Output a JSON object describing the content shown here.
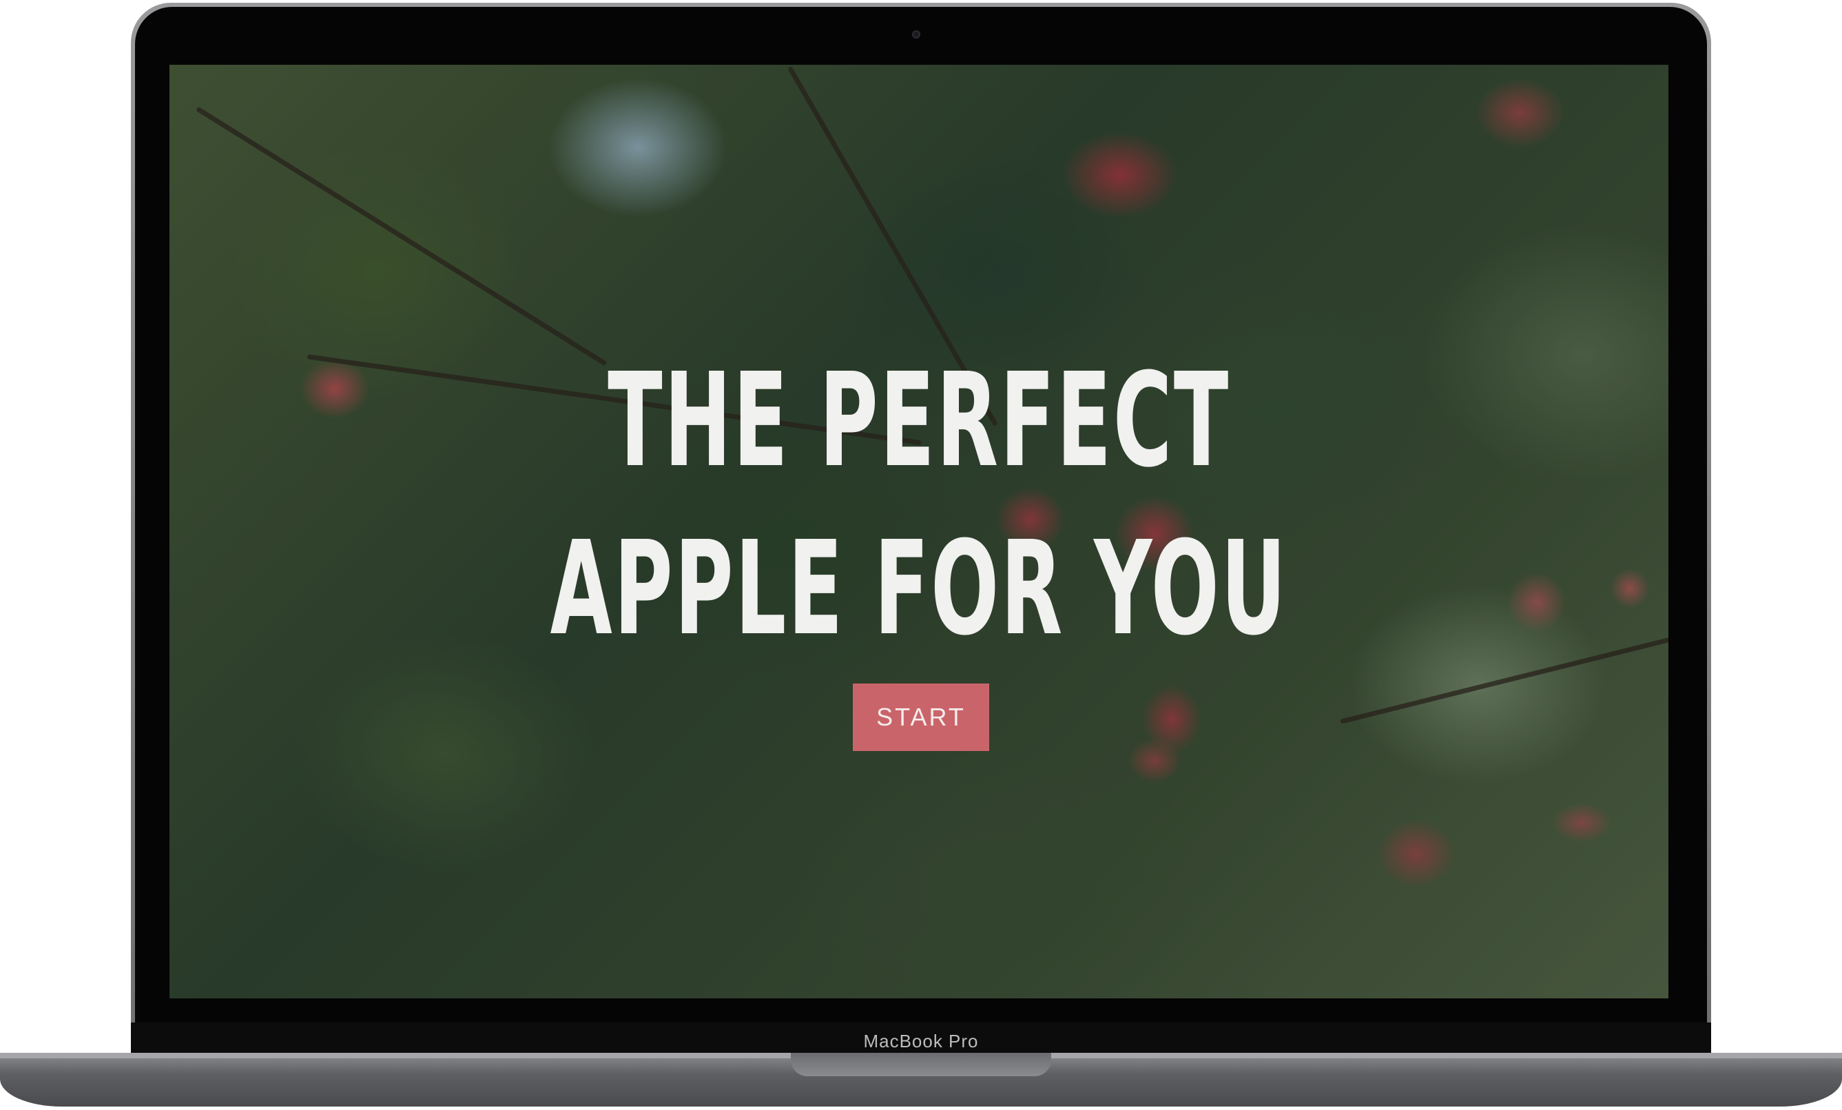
{
  "hero": {
    "title": "THE PERFECT\nAPPLE FOR YOU",
    "start_label": "START"
  },
  "device": {
    "model": "MacBook Pro"
  },
  "colors": {
    "button": "#c9656a",
    "title_text": "#f1f1ef"
  }
}
